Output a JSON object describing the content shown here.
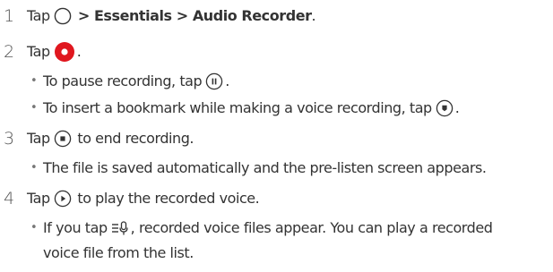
{
  "steps": [
    {
      "number": "1",
      "parts": {
        "tap": "Tap",
        "sep1": " > ",
        "essentials": "Essentials",
        "sep2": " > ",
        "audio_recorder": "Audio Recorder",
        "end": "."
      },
      "icon": "home-circle-icon"
    },
    {
      "number": "2",
      "parts": {
        "tap": "Tap",
        "end": "."
      },
      "icon": "record-button-icon",
      "accent_color": "#e0171f",
      "bullets": [
        {
          "before": "To pause recording, tap",
          "after": ".",
          "icon": "pause-icon"
        },
        {
          "before": "To insert a bookmark while making a voice recording, tap",
          "after": ".",
          "icon": "bookmark-icon"
        }
      ]
    },
    {
      "number": "3",
      "parts": {
        "tap": "Tap",
        "after": " to end recording."
      },
      "icon": "stop-icon",
      "bullets": [
        {
          "text": "The file is saved automatically and the pre-listen screen appears."
        }
      ]
    },
    {
      "number": "4",
      "parts": {
        "tap": "Tap",
        "after": " to play the recorded voice."
      },
      "icon": "play-icon",
      "bullets": [
        {
          "before": "If you tap",
          "after": ", recorded voice files appear. You can play a recorded",
          "line2": "voice file from the list.",
          "icon": "recordings-list-icon"
        }
      ]
    }
  ],
  "bullet_char": "•"
}
